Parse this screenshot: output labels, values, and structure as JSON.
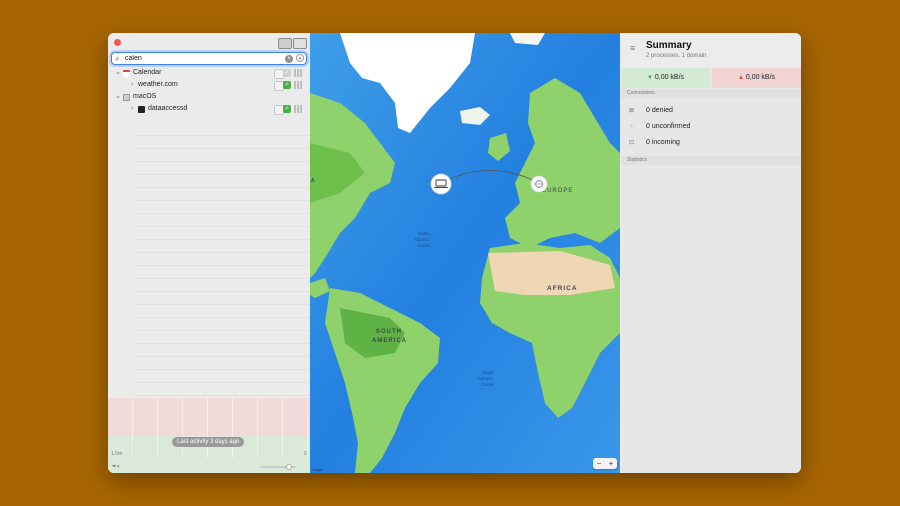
{
  "sidebar": {
    "search": {
      "value": "calen",
      "placeholder": ""
    },
    "tree": [
      {
        "label": "Calendar",
        "level": 0,
        "expanded": true
      },
      {
        "label": "weather.com",
        "level": 1,
        "expanded": false
      },
      {
        "label": "macOS",
        "level": 0,
        "expanded": true
      },
      {
        "label": "dataaccessd",
        "level": 1,
        "expanded": false
      }
    ],
    "activity_badge": "Last activity 3 days ago",
    "axis_left": "1.0m",
    "axis_right": "0"
  },
  "map": {
    "regions": {
      "europe": "EUROPE",
      "africa": "AFRICA",
      "south_america_1": "SOUTH",
      "south_america_2": "AMERICA",
      "north_atlantic_1": "North",
      "north_atlantic_2": "Atlantic",
      "north_atlantic_3": "Ocean",
      "south_atlantic_1": "South",
      "south_atlantic_2": "Atlantic",
      "south_atlantic_3": "Ocean",
      "edge_a": "A"
    },
    "zoom_out": "−",
    "zoom_in": "+",
    "credit": "Legal"
  },
  "summary": {
    "title": "Summary",
    "subtitle": "2 processes, 1 domain",
    "download_rate": "0,00 kB/s",
    "upload_rate": "0,00 kB/s",
    "connections_header": "Connections",
    "connections": [
      {
        "icon": "denied-icon",
        "label": "0 denied"
      },
      {
        "icon": "unconfirmed-icon",
        "label": "0 unconfirmed"
      },
      {
        "icon": "incoming-icon",
        "label": "0 incoming"
      }
    ],
    "statistics_header": "Statistics"
  },
  "colors": {
    "background": "#a66500",
    "accent": "#3b82f6",
    "allow_green": "#49b04a",
    "download_bg": "#d3ebd2",
    "upload_bg": "#f2d3d3",
    "ocean": "#2b8be6",
    "land": "#8fd16a"
  }
}
